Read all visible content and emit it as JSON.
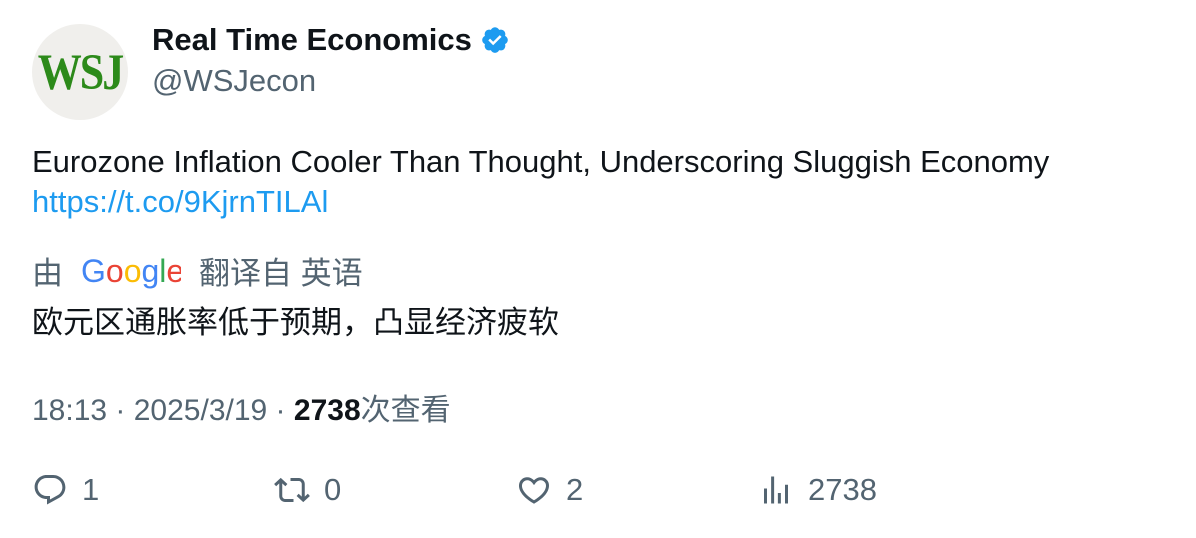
{
  "author": {
    "avatar_text": "WSJ",
    "display_name": "Real Time Economics",
    "handle": "@WSJecon",
    "verified_icon": "verified-badge-icon",
    "verified_color": "#1d9bf0"
  },
  "tweet": {
    "text": "Eurozone Inflation Cooler Than Thought, Underscoring Sluggish Economy",
    "link": "https://t.co/9KjrnTILAl"
  },
  "translation": {
    "prefix": "由",
    "provider_logo": "Google",
    "suffix": "翻译自 英语",
    "text": "欧元区通胀率低于预期，凸显经济疲软"
  },
  "meta": {
    "time": "18:13",
    "sep1": " · ",
    "date": "2025/3/19",
    "sep2": " · ",
    "views_count": "2738",
    "views_label": "次查看"
  },
  "actions": {
    "reply_count": "1",
    "retweet_count": "0",
    "like_count": "2",
    "views_count": "2738"
  },
  "colors": {
    "link": "#1d9bf0",
    "secondary_text": "#536471",
    "primary_text": "#0f1419",
    "avatar_bg": "#f0efec",
    "avatar_logo": "#2c8a1a"
  }
}
